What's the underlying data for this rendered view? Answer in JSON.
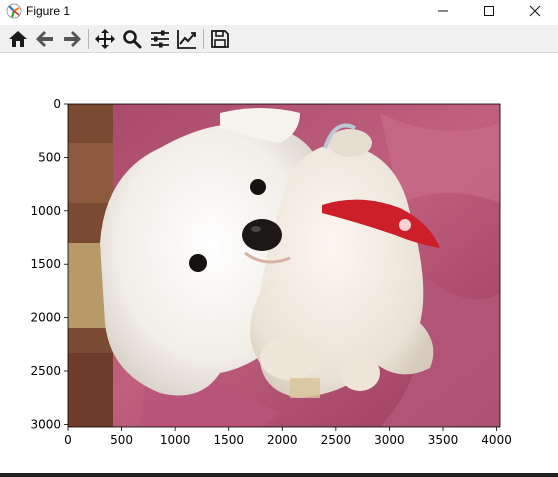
{
  "window": {
    "title": "Figure 1",
    "controls": {
      "minimize": "—",
      "maximize": "☐",
      "close": "✕"
    }
  },
  "toolbar": {
    "buttons": [
      {
        "name": "home",
        "icon": "home-icon"
      },
      {
        "name": "back",
        "icon": "arrow-left-icon"
      },
      {
        "name": "forward",
        "icon": "arrow-right-icon"
      },
      {
        "name": "pan",
        "icon": "move-icon"
      },
      {
        "name": "zoom",
        "icon": "magnifier-icon"
      },
      {
        "name": "subplots",
        "icon": "sliders-icon"
      },
      {
        "name": "customize",
        "icon": "line-chart-icon"
      },
      {
        "name": "save",
        "icon": "floppy-disk-icon"
      }
    ]
  },
  "axes": {
    "xticks": [
      "0",
      "500",
      "1000",
      "1500",
      "2000",
      "2500",
      "3000",
      "3500",
      "4000"
    ],
    "yticks": [
      "0",
      "500",
      "1000",
      "1500",
      "2000",
      "2500",
      "3000"
    ],
    "image_description": "fluffy white dog hugging a plush toy with red scarf on pink blanket",
    "colors": {
      "blanket": "#b0506e",
      "fur": "#f2efea",
      "scarf": "#cc1f2a"
    }
  }
}
